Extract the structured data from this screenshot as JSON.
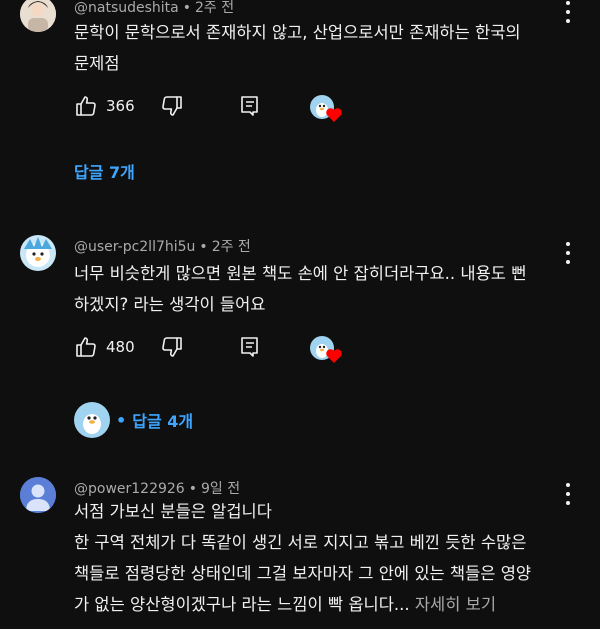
{
  "comments": [
    {
      "author": "@natsudeshita",
      "time": "2주 전",
      "text_lines": [
        "문학이 문학으로서 존재하지 않고, 산업으로서만 존재하는 한국의",
        "문제점"
      ],
      "likes": "366",
      "replies_label": "답글 7개"
    },
    {
      "author": "@user-pc2ll7hi5u",
      "time": "2주 전",
      "text_lines": [
        "너무 비슷한게 많으면 원본 책도 손에 안 잡히더라구요.. 내용도 뻔",
        "하겠지? 라는 생각이 들어요"
      ],
      "likes": "480",
      "replies_label": "답글 4개",
      "reply_bullet": "•"
    },
    {
      "author": "@power122926",
      "time": "9일 전",
      "text_lines": [
        "서점 가보신 분들은 알겁니다",
        "한 구역 전체가 다 똑같이 생긴 서로 지지고 볶고 베낀 듯한 수많은",
        "책들로 점령당한 상태인데 그걸 보자마자 그 안에 있는 책들은 영양",
        "가 없는 양산형이겠구나 라는 느낌이 빡 옵니다..."
      ],
      "read_more": "자세히 보기"
    }
  ],
  "separator": "•",
  "colors": {
    "background": "#0f0f0f",
    "text": "#f1f1f1",
    "meta": "#aaaaaa",
    "link": "#3ea6ff",
    "heart": "#ff0000"
  }
}
